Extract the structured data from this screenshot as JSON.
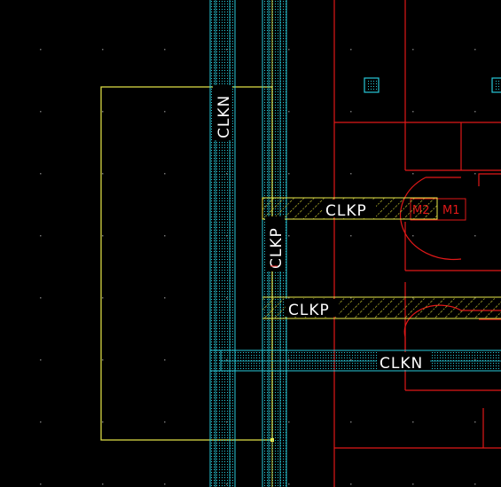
{
  "layout_view": {
    "background_color": "#000000",
    "layer_colors": {
      "metal_blue": "#27c8d8",
      "metal_yellow": "#e8e84a",
      "outline_red": "#e01818",
      "grid_dot": "#707070"
    },
    "nets": {
      "clkn_vertical": "CLKN",
      "clkn_horizontal": "CLKN",
      "clkp_vertical": "CLKP",
      "clkp_upper": "CLKP",
      "clkp_lower": "CLKP"
    },
    "device_labels": {
      "m2": "M2",
      "m1": "M1"
    }
  }
}
